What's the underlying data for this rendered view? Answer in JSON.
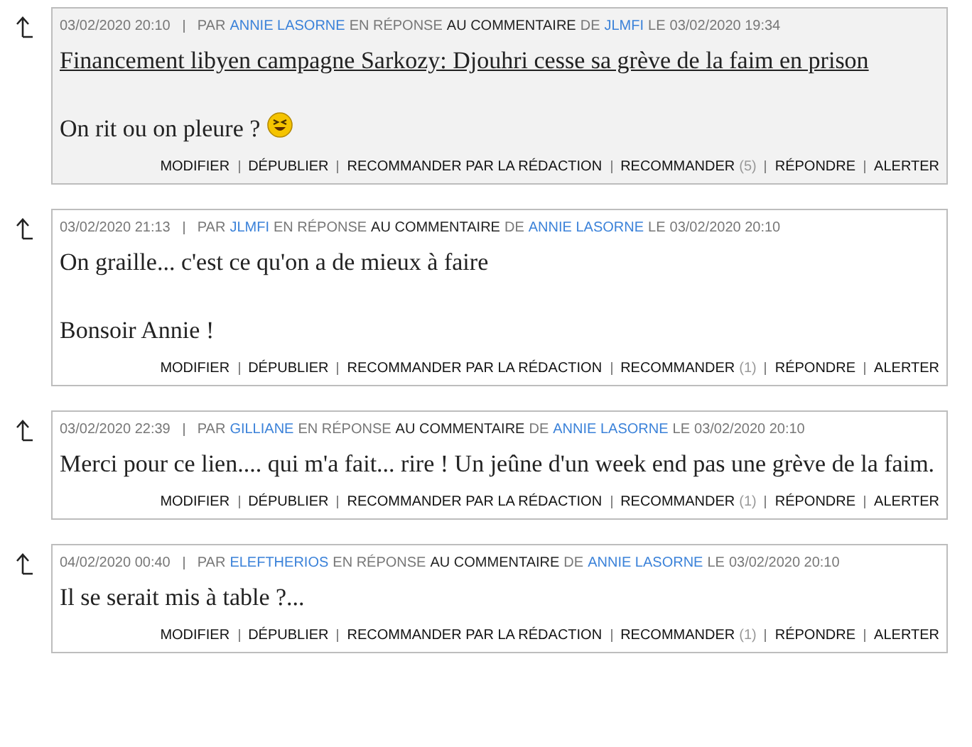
{
  "comments": [
    {
      "highlighted": true,
      "date": "03/02/2020 20:10",
      "by": "PAR",
      "author": "ANNIE LASORNE",
      "reply": "EN RÉPONSE",
      "to_comment": "AU COMMENTAIRE",
      "of": "DE",
      "parent_author": "JLMFI",
      "on": "LE",
      "parent_date": "03/02/2020 19:34",
      "paragraphs": [
        {
          "kind": "link",
          "text": "Financement libyen campagne Sarkozy: Djouhri cesse sa grève de la faim en prison",
          "emoji": false
        },
        {
          "kind": "text",
          "text": "On rit ou on pleure ?",
          "emoji": true
        }
      ],
      "actions": [
        {
          "label": "MODIFIER"
        },
        {
          "label": "DÉPUBLIER"
        },
        {
          "label": "RECOMMANDER PAR LA RÉDACTION"
        },
        {
          "label": "RECOMMANDER",
          "count": "(5)"
        },
        {
          "label": "RÉPONDRE"
        },
        {
          "label": "ALERTER"
        }
      ]
    },
    {
      "highlighted": false,
      "date": "03/02/2020 21:13",
      "by": "PAR",
      "author": "JLMFI",
      "reply": "EN RÉPONSE",
      "to_comment": "AU COMMENTAIRE",
      "of": "DE",
      "parent_author": "ANNIE LASORNE",
      "on": "LE",
      "parent_date": "03/02/2020 20:10",
      "paragraphs": [
        {
          "kind": "text",
          "text": "On graille... c'est ce qu'on a de mieux à faire",
          "emoji": false
        },
        {
          "kind": "text",
          "text": "Bonsoir Annie !",
          "emoji": false
        }
      ],
      "actions": [
        {
          "label": "MODIFIER"
        },
        {
          "label": "DÉPUBLIER"
        },
        {
          "label": "RECOMMANDER PAR LA RÉDACTION"
        },
        {
          "label": "RECOMMANDER",
          "count": "(1)"
        },
        {
          "label": "RÉPONDRE"
        },
        {
          "label": "ALERTER"
        }
      ]
    },
    {
      "highlighted": false,
      "date": "03/02/2020 22:39",
      "by": "PAR",
      "author": "GILLIANE",
      "reply": "EN RÉPONSE",
      "to_comment": "AU COMMENTAIRE",
      "of": "DE",
      "parent_author": "ANNIE LASORNE",
      "on": "LE",
      "parent_date": "03/02/2020 20:10",
      "paragraphs": [
        {
          "kind": "text",
          "text": "Merci pour ce lien.... qui m'a fait... rire ! Un jeûne d'un week end pas une grève de la faim.",
          "emoji": false
        }
      ],
      "actions": [
        {
          "label": "MODIFIER"
        },
        {
          "label": "DÉPUBLIER"
        },
        {
          "label": "RECOMMANDER PAR LA RÉDACTION"
        },
        {
          "label": "RECOMMANDER",
          "count": "(1)"
        },
        {
          "label": "RÉPONDRE"
        },
        {
          "label": "ALERTER"
        }
      ]
    },
    {
      "highlighted": false,
      "date": "04/02/2020 00:40",
      "by": "PAR",
      "author": "ELEFTHERIOS",
      "reply": "EN RÉPONSE",
      "to_comment": "AU COMMENTAIRE",
      "of": "DE",
      "parent_author": "ANNIE LASORNE",
      "on": "LE",
      "parent_date": "03/02/2020 20:10",
      "paragraphs": [
        {
          "kind": "text",
          "text": "Il se serait mis à table ?...",
          "emoji": false
        }
      ],
      "actions": [
        {
          "label": "MODIFIER"
        },
        {
          "label": "DÉPUBLIER"
        },
        {
          "label": "RECOMMANDER PAR LA RÉDACTION"
        },
        {
          "label": "RECOMMANDER",
          "count": "(1)"
        },
        {
          "label": "RÉPONDRE"
        },
        {
          "label": "ALERTER"
        }
      ]
    }
  ]
}
